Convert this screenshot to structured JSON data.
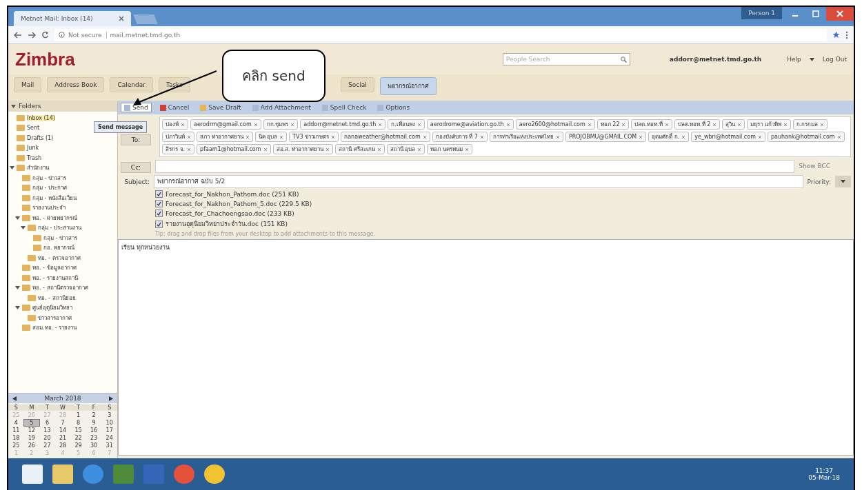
{
  "browser": {
    "tab_title": "Metnet Mail: Inbox (14)",
    "security": "Not secure",
    "url": "mail.metnet.tmd.go.th",
    "profile": "Person 1"
  },
  "header": {
    "logo": "Zimbra",
    "search_placeholder": "People Search",
    "user": "addorr@metnet.tmd.go.th",
    "help": "Help",
    "logout": "Log Out"
  },
  "app_tabs": [
    {
      "label": "Mail",
      "selected": false
    },
    {
      "label": "Address Book",
      "selected": false
    },
    {
      "label": "Calendar",
      "selected": false
    },
    {
      "label": "Tasks",
      "selected": false
    },
    {
      "label": "Social",
      "selected": false
    },
    {
      "label": "พยากรณ์อากาศ",
      "selected": true
    }
  ],
  "folders_label": "Folders",
  "folders": [
    {
      "label": "Inbox (14)",
      "selected": true
    },
    {
      "label": "Sent",
      "selected": false
    },
    {
      "label": "Drafts (1)",
      "selected": false
    },
    {
      "label": "Junk",
      "selected": false
    },
    {
      "label": "Trash",
      "selected": false
    },
    {
      "label": "สำนักงาน",
      "selected": false,
      "children": [
        {
          "label": "กลุ่ม - ข่าวสาร",
          "selected": false
        },
        {
          "label": "กลุ่ม - ประกาศ",
          "selected": false
        },
        {
          "label": "กลุ่ม - หนังสือเวียน",
          "selected": false
        },
        {
          "label": "รายงานประจำ",
          "selected": false
        },
        {
          "label": "ทอ. - ฝ่ายพยากรณ์",
          "selected": false,
          "children": [
            {
              "label": "กลุ่ม - ประสานงาน",
              "selected": false,
              "children": [
                {
                  "label": "กลุ่ม - ข่าวสาร",
                  "selected": false
                },
                {
                  "label": "กอ. พยากรณ์",
                  "selected": false
                }
              ]
            },
            {
              "label": "ทอ. - ตรวจอากาศ",
              "selected": false
            }
          ]
        },
        {
          "label": "ทอ. - ข้อมูลอากาศ",
          "selected": false
        },
        {
          "label": "ทอ. - รายงานสถานี",
          "selected": false
        },
        {
          "label": "ทอ. - สถานีตรวจอากาศ",
          "selected": false,
          "children": [
            {
              "label": "ทอ. - สถานีย่อย",
              "selected": false
            }
          ]
        },
        {
          "label": "ศูนย์อุตุนิยมวิทยา",
          "selected": false,
          "children": [
            {
              "label": "ข่าวสารอากาศ",
              "selected": false
            }
          ]
        },
        {
          "label": "สอม.ทอ. - รายงาน",
          "selected": false
        }
      ]
    }
  ],
  "calendar": {
    "title": "March 2018",
    "weekdays": [
      "S",
      "M",
      "T",
      "W",
      "T",
      "F",
      "S"
    ],
    "weeks": [
      [
        {
          "day": "25",
          "selected": false,
          "other": true
        },
        {
          "day": "26",
          "selected": false,
          "other": true
        },
        {
          "day": "27",
          "selected": false,
          "other": true
        },
        {
          "day": "28",
          "selected": false,
          "other": true
        },
        {
          "day": "1",
          "selected": false,
          "other": false
        },
        {
          "day": "2",
          "selected": false,
          "other": false
        },
        {
          "day": "3",
          "selected": false,
          "other": false
        }
      ],
      [
        {
          "day": "4",
          "selected": false,
          "other": false
        },
        {
          "day": "5",
          "selected": true,
          "other": false
        },
        {
          "day": "6",
          "selected": false,
          "other": false
        },
        {
          "day": "7",
          "selected": false,
          "other": false
        },
        {
          "day": "8",
          "selected": false,
          "other": false
        },
        {
          "day": "9",
          "selected": false,
          "other": false
        },
        {
          "day": "10",
          "selected": false,
          "other": false
        }
      ],
      [
        {
          "day": "11",
          "selected": false,
          "other": false
        },
        {
          "day": "12",
          "selected": false,
          "other": false
        },
        {
          "day": "13",
          "selected": false,
          "other": false
        },
        {
          "day": "14",
          "selected": false,
          "other": false
        },
        {
          "day": "15",
          "selected": false,
          "other": false
        },
        {
          "day": "16",
          "selected": false,
          "other": false
        },
        {
          "day": "17",
          "selected": false,
          "other": false
        }
      ],
      [
        {
          "day": "18",
          "selected": false,
          "other": false
        },
        {
          "day": "19",
          "selected": false,
          "other": false
        },
        {
          "day": "20",
          "selected": false,
          "other": false
        },
        {
          "day": "21",
          "selected": false,
          "other": false
        },
        {
          "day": "22",
          "selected": false,
          "other": false
        },
        {
          "day": "23",
          "selected": false,
          "other": false
        },
        {
          "day": "24",
          "selected": false,
          "other": false
        }
      ],
      [
        {
          "day": "25",
          "selected": false,
          "other": false
        },
        {
          "day": "26",
          "selected": false,
          "other": false
        },
        {
          "day": "27",
          "selected": false,
          "other": false
        },
        {
          "day": "28",
          "selected": false,
          "other": false
        },
        {
          "day": "29",
          "selected": false,
          "other": false
        },
        {
          "day": "30",
          "selected": false,
          "other": false
        },
        {
          "day": "31",
          "selected": false,
          "other": false
        }
      ],
      [
        {
          "day": "1",
          "selected": false,
          "other": true
        },
        {
          "day": "2",
          "selected": false,
          "other": true
        },
        {
          "day": "3",
          "selected": false,
          "other": true
        },
        {
          "day": "4",
          "selected": false,
          "other": true
        },
        {
          "day": "5",
          "selected": false,
          "other": true
        },
        {
          "day": "6",
          "selected": false,
          "other": true
        },
        {
          "day": "7",
          "selected": false,
          "other": true
        }
      ]
    ]
  },
  "compose_toolbar": [
    "Send",
    "Cancel",
    "Save Draft",
    "Add Attachment",
    "Spell Check",
    "Options"
  ],
  "tooltip": "Send message",
  "to_label": "To:",
  "recipients": [
    "ปองพ์",
    "aerodrm@gmail.com",
    "กก.ชุมพร",
    "addorr@metnet.tmd.go.th",
    "ก.เพื่อนพง",
    "aerodrome@aviation.go.th",
    "aero2600@hotmail.com",
    "ทอภ 22",
    "ปลด.ทอท.ที่",
    "ปลด.ทอท.ที่ 2",
    "สุวิน",
    "มยุรา แก้วทิพ",
    "ก.กรกมล",
    "ปภาวินท์",
    "สภา ท่าอากาศยาน",
    "นิค อุบล",
    "TV3 ข่าวเกษตร",
    "nanaweather@hotmail.com",
    "กองบังคับการ ที่ 7",
    "การท่าเรือแห่งประเทศไทย",
    "PROJOBMU@GMAIL.COM",
    "อุดมศักดิ์ ก.",
    "ye_wbri@hotmail.com",
    "pauhank@hotmail.com",
    "สิรกร จ.",
    "pfaam1@hotmail.com",
    "สอ.ส. ท่าอากาศยาน",
    "สถานี ศรีสะเกษ",
    "สถานี อุบล",
    "ทอภ นครพนม"
  ],
  "cc_label": "Cc:",
  "show_bcc": "Show BCC",
  "subject_label": "Subject:",
  "subject": "พยากรณ์อากาศ ฉบับ 5/2",
  "priority_label": "Priority:",
  "attachments": [
    {
      "label": "Forecast_for_Nakhon_Pathom.doc (251 KB)",
      "checked": true
    },
    {
      "label": "Forecast_for_Nakhon_Pathom_5.doc (229.5 KB)",
      "checked": true
    },
    {
      "label": "Forecast_for_Chachoengsao.doc (233 KB)",
      "checked": true
    },
    {
      "label": "รายงานอุตุนิยมวิทยาประจำวัน.doc (151 KB)",
      "checked": true
    }
  ],
  "tip": "Tip: drag and drop files from your desktop to add attachments to this message.",
  "body": "เรียน ทุกหน่วยงาน",
  "callout": "คลิก send",
  "clock": {
    "time": "11:37",
    "date": "05-Mar-18"
  }
}
